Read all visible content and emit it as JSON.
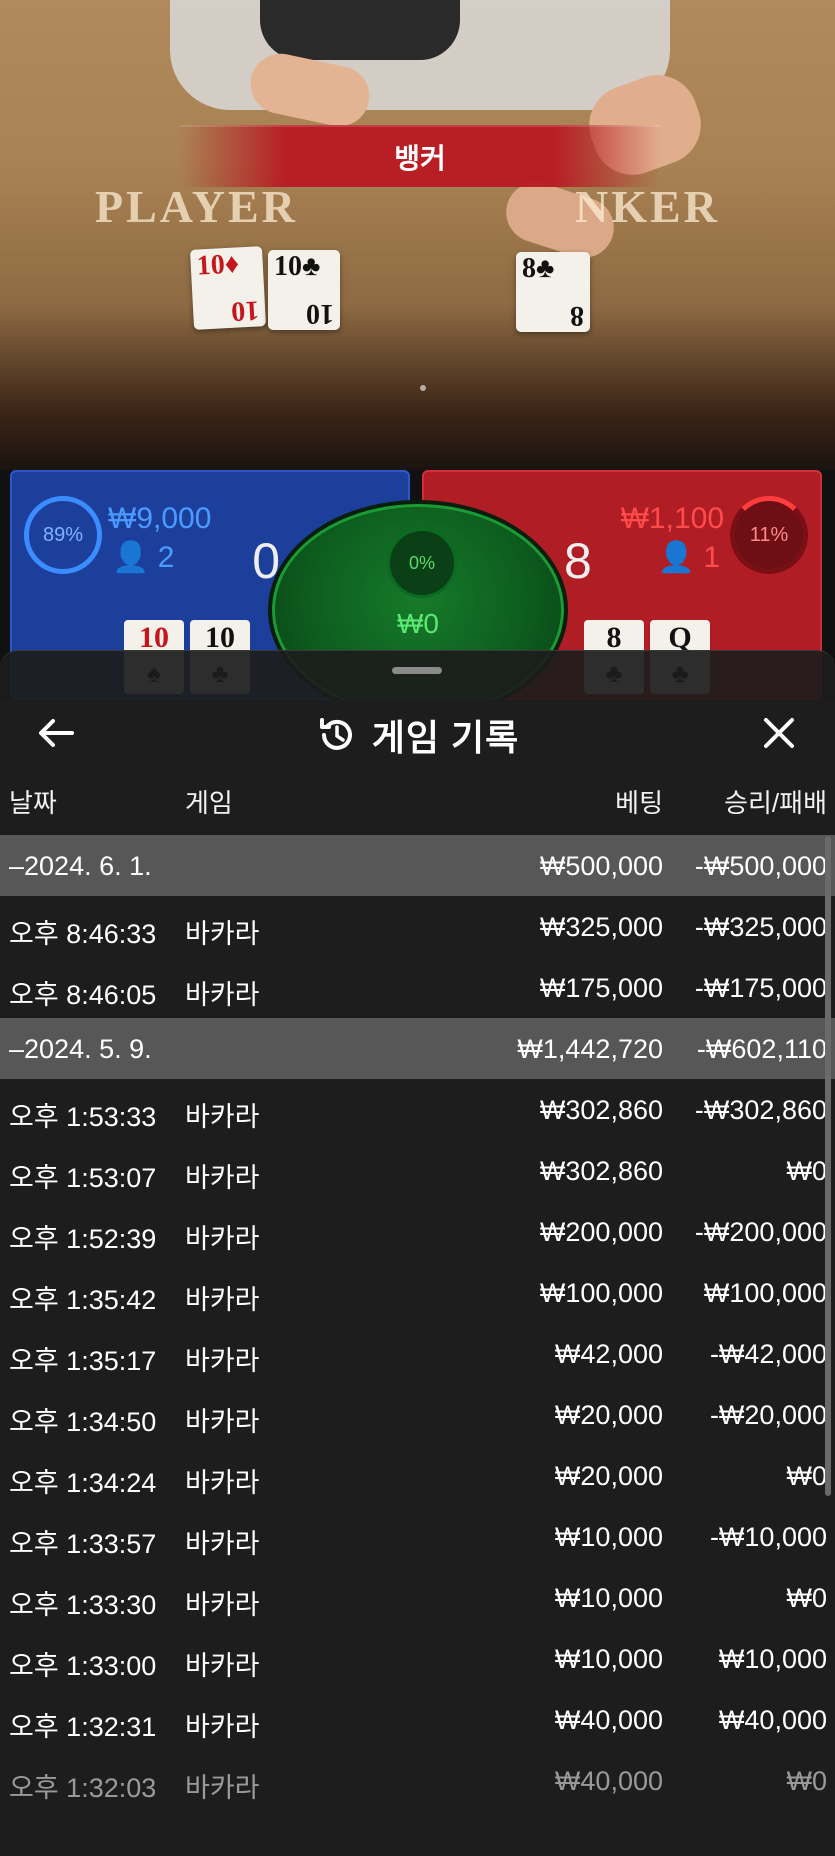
{
  "stream": {
    "banner": "뱅커",
    "table_labels": {
      "player": "PLAYER",
      "banker": "NKER"
    },
    "player_cards": [
      {
        "rank": "10",
        "suit": "♦",
        "color": "red"
      },
      {
        "rank": "10",
        "suit": "♣",
        "color": "black"
      }
    ],
    "banker_cards": [
      {
        "rank": "8",
        "suit": "♣",
        "color": "black"
      }
    ]
  },
  "bet_panels": {
    "player": {
      "percent": "89%",
      "amount": "₩9,000",
      "bettors": "2",
      "score": "0",
      "cards": [
        {
          "rank": "10",
          "suit": "♠"
        },
        {
          "rank": "10",
          "suit": "♣"
        }
      ]
    },
    "tie": {
      "percent": "0%",
      "amount": "₩0"
    },
    "banker": {
      "percent": "11%",
      "amount": "₩1,100",
      "bettors": "1",
      "score": "8",
      "cards": [
        {
          "rank": "8",
          "suit": "♣"
        },
        {
          "rank": "Q",
          "suit": "♣"
        }
      ]
    }
  },
  "sheet": {
    "title": "게임 기록",
    "columns": {
      "date": "날짜",
      "game": "게임",
      "bet": "베팅",
      "result": "승리/패배"
    },
    "rows": [
      {
        "type": "date",
        "date": "–2024. 6. 1.",
        "game": "",
        "bet": "₩500,000",
        "result": "-₩500,000"
      },
      {
        "type": "entry",
        "date": "오후 8:46:33",
        "game": "바카라",
        "bet": "₩325,000",
        "result": "-₩325,000"
      },
      {
        "type": "entry",
        "date": "오후 8:46:05",
        "game": "바카라",
        "bet": "₩175,000",
        "result": "-₩175,000"
      },
      {
        "type": "date",
        "date": "–2024. 5. 9.",
        "game": "",
        "bet": "₩1,442,720",
        "result": "-₩602,110"
      },
      {
        "type": "entry",
        "date": "오후 1:53:33",
        "game": "바카라",
        "bet": "₩302,860",
        "result": "-₩302,860"
      },
      {
        "type": "entry",
        "date": "오후 1:53:07",
        "game": "바카라",
        "bet": "₩302,860",
        "result": "₩0"
      },
      {
        "type": "entry",
        "date": "오후 1:52:39",
        "game": "바카라",
        "bet": "₩200,000",
        "result": "-₩200,000"
      },
      {
        "type": "entry",
        "date": "오후 1:35:42",
        "game": "바카라",
        "bet": "₩100,000",
        "result": "₩100,000"
      },
      {
        "type": "entry",
        "date": "오후 1:35:17",
        "game": "바카라",
        "bet": "₩42,000",
        "result": "-₩42,000"
      },
      {
        "type": "entry",
        "date": "오후 1:34:50",
        "game": "바카라",
        "bet": "₩20,000",
        "result": "-₩20,000"
      },
      {
        "type": "entry",
        "date": "오후 1:34:24",
        "game": "바카라",
        "bet": "₩20,000",
        "result": "₩0"
      },
      {
        "type": "entry",
        "date": "오후 1:33:57",
        "game": "바카라",
        "bet": "₩10,000",
        "result": "-₩10,000"
      },
      {
        "type": "entry",
        "date": "오후 1:33:30",
        "game": "바카라",
        "bet": "₩10,000",
        "result": "₩0"
      },
      {
        "type": "entry",
        "date": "오후 1:33:00",
        "game": "바카라",
        "bet": "₩10,000",
        "result": "₩10,000"
      },
      {
        "type": "entry",
        "date": "오후 1:32:31",
        "game": "바카라",
        "bet": "₩40,000",
        "result": "₩40,000"
      },
      {
        "type": "entry",
        "date": "오후 1:32:03",
        "game": "바카라",
        "bet": "₩40,000",
        "result": "₩0"
      }
    ]
  },
  "icons": {
    "back": "arrow-left-icon",
    "history": "history-clock-icon",
    "close": "close-icon"
  }
}
